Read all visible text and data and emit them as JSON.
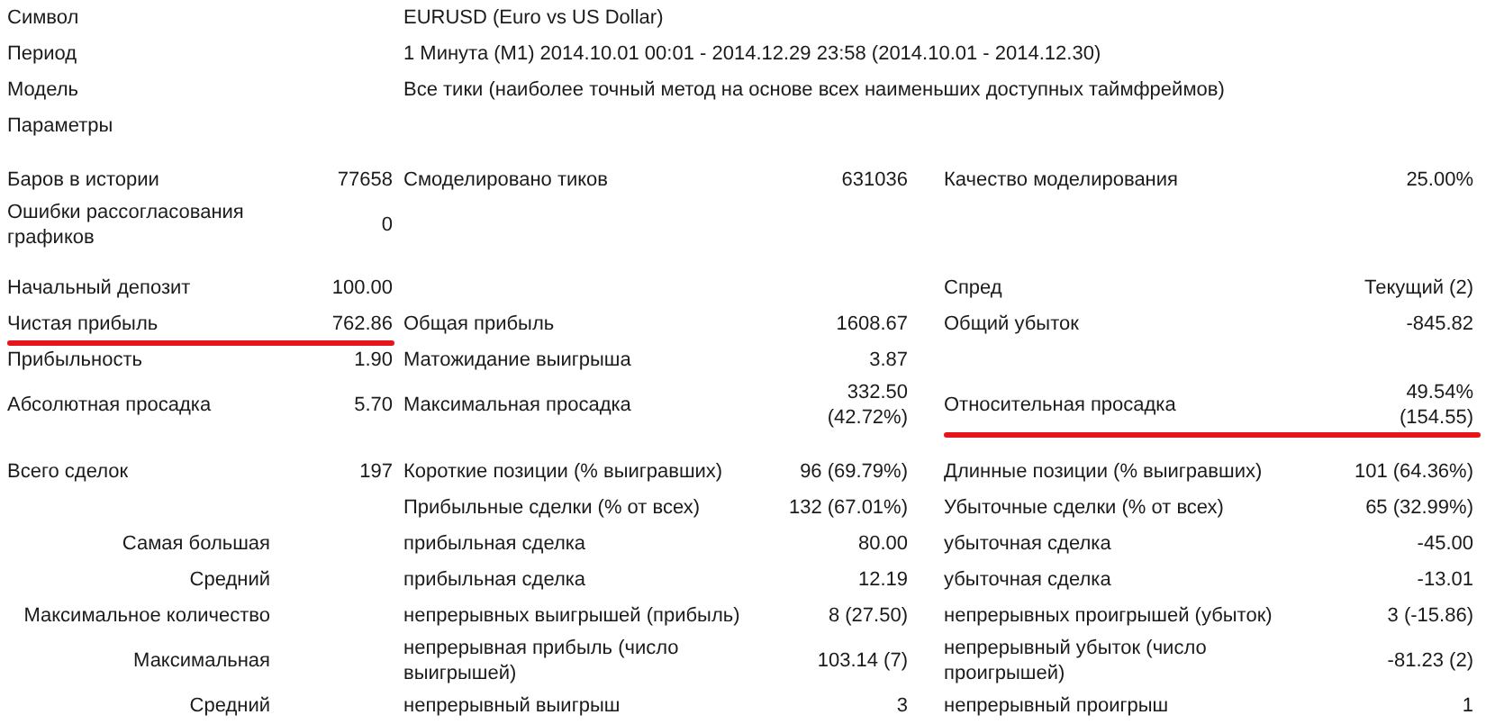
{
  "sections": [
    {
      "rows": [
        {
          "kind": "info",
          "cells": [
            "Символ",
            "EURUSD (Euro vs US Dollar)"
          ]
        },
        {
          "kind": "info",
          "cells": [
            "Период",
            "1 Минута (M1) 2014.10.01 00:01 - 2014.12.29 23:58 (2014.10.01 - 2014.12.30)"
          ]
        },
        {
          "kind": "info",
          "cells": [
            "Модель",
            "Все тики (наиболее точный метод на основе всех наименьших доступных таймфреймов)"
          ]
        },
        {
          "kind": "info",
          "cells": [
            "Параметры",
            null
          ]
        }
      ]
    },
    {
      "rows": [
        {
          "kind": "stat",
          "cells": [
            "Баров в истории",
            "77658",
            "Смоделировано тиков",
            "631036",
            "Качество моделирования",
            "25.00%"
          ]
        },
        {
          "kind": "stat",
          "cells": [
            "Ошибки рассогласования\nграфиков",
            "0",
            null,
            null,
            null,
            null
          ]
        }
      ]
    },
    {
      "rows": [
        {
          "kind": "stat",
          "cells": [
            "Начальный депозит",
            "100.00",
            null,
            null,
            "Спред",
            "Текущий (2)"
          ]
        },
        {
          "kind": "stat",
          "cells": [
            "Чистая прибыль",
            "762.86",
            "Общая прибыль",
            "1608.67",
            "Общий убыток",
            "-845.82"
          ],
          "underline_left": true
        },
        {
          "kind": "stat",
          "cells": [
            "Прибыльность",
            "1.90",
            "Матожидание выигрыша",
            "3.87",
            null,
            null
          ]
        },
        {
          "kind": "stat",
          "cells": [
            "Абсолютная просадка",
            "5.70",
            "Максимальная просадка",
            "332.50\n(42.72%)",
            "Относительная просадка",
            "49.54%\n(154.55)"
          ],
          "underline_right": true
        }
      ]
    },
    {
      "rows": [
        {
          "kind": "stat",
          "cells": [
            "Всего сделок",
            "197",
            "Короткие позиции (% выигравших)",
            "96 (69.79%)",
            "Длинные позиции (% выигравших)",
            "101 (64.36%)"
          ]
        },
        {
          "kind": "trade",
          "cells": [
            null,
            null,
            "Прибыльные сделки (% от всех)",
            "132 (67.01%)",
            "Убыточные сделки (% от всех)",
            "65 (32.99%)"
          ]
        },
        {
          "kind": "trade",
          "cells": [
            "Самая большая",
            null,
            "прибыльная сделка",
            "80.00",
            "убыточная сделка",
            "-45.00"
          ]
        },
        {
          "kind": "trade",
          "cells": [
            "Средний",
            null,
            "прибыльная сделка",
            "12.19",
            "убыточная сделка",
            "-13.01"
          ]
        },
        {
          "kind": "trade",
          "cells": [
            "Максимальное количество",
            null,
            "непрерывных выигрышей (прибыль)",
            "8 (27.50)",
            "непрерывных проигрышей (убыток)",
            "3 (-15.86)"
          ]
        },
        {
          "kind": "trade",
          "cells": [
            "Максимальная",
            null,
            "непрерывная прибыль (число\nвыигрышей)",
            "103.14 (7)",
            "непрерывный убыток (число\nпроигрышей)",
            "-81.23 (2)"
          ]
        },
        {
          "kind": "trade",
          "cells": [
            "Средний",
            null,
            "непрерывный выигрыш",
            "3",
            "непрерывный проигрыш",
            "1"
          ]
        }
      ]
    }
  ]
}
